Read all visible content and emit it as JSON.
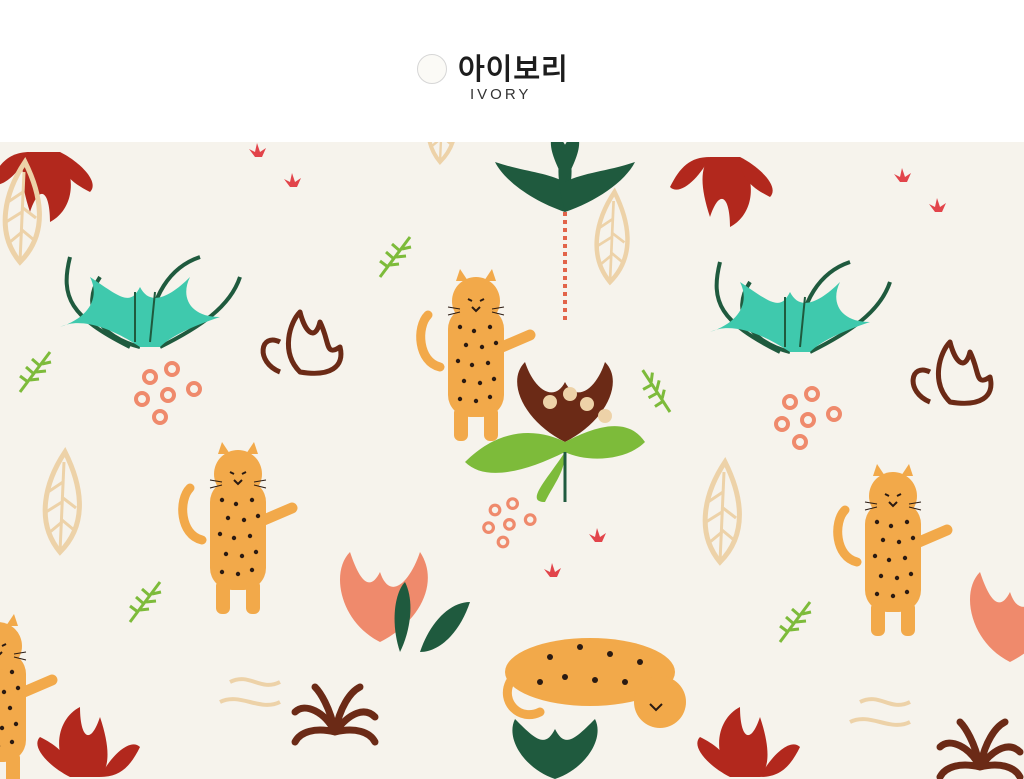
{
  "option": {
    "swatch_color": "#fbfaf6",
    "name_ko": "아이보리",
    "name_en": "IVORY"
  },
  "fabric_photo": {
    "background": "#f6f3ec",
    "motif_colors": {
      "leopard": "#f2a94a",
      "spots": "#2a1a12",
      "teal_leaf": "#3fc9ad",
      "dark_green": "#1f5a3e",
      "light_green": "#7dbb3a",
      "coral": "#ef8a6c",
      "red_leaf": "#b2281d",
      "brown_leaf": "#6b2a16",
      "beige_leaf": "#edd2a8",
      "pink_flower": "#e2444a"
    }
  }
}
